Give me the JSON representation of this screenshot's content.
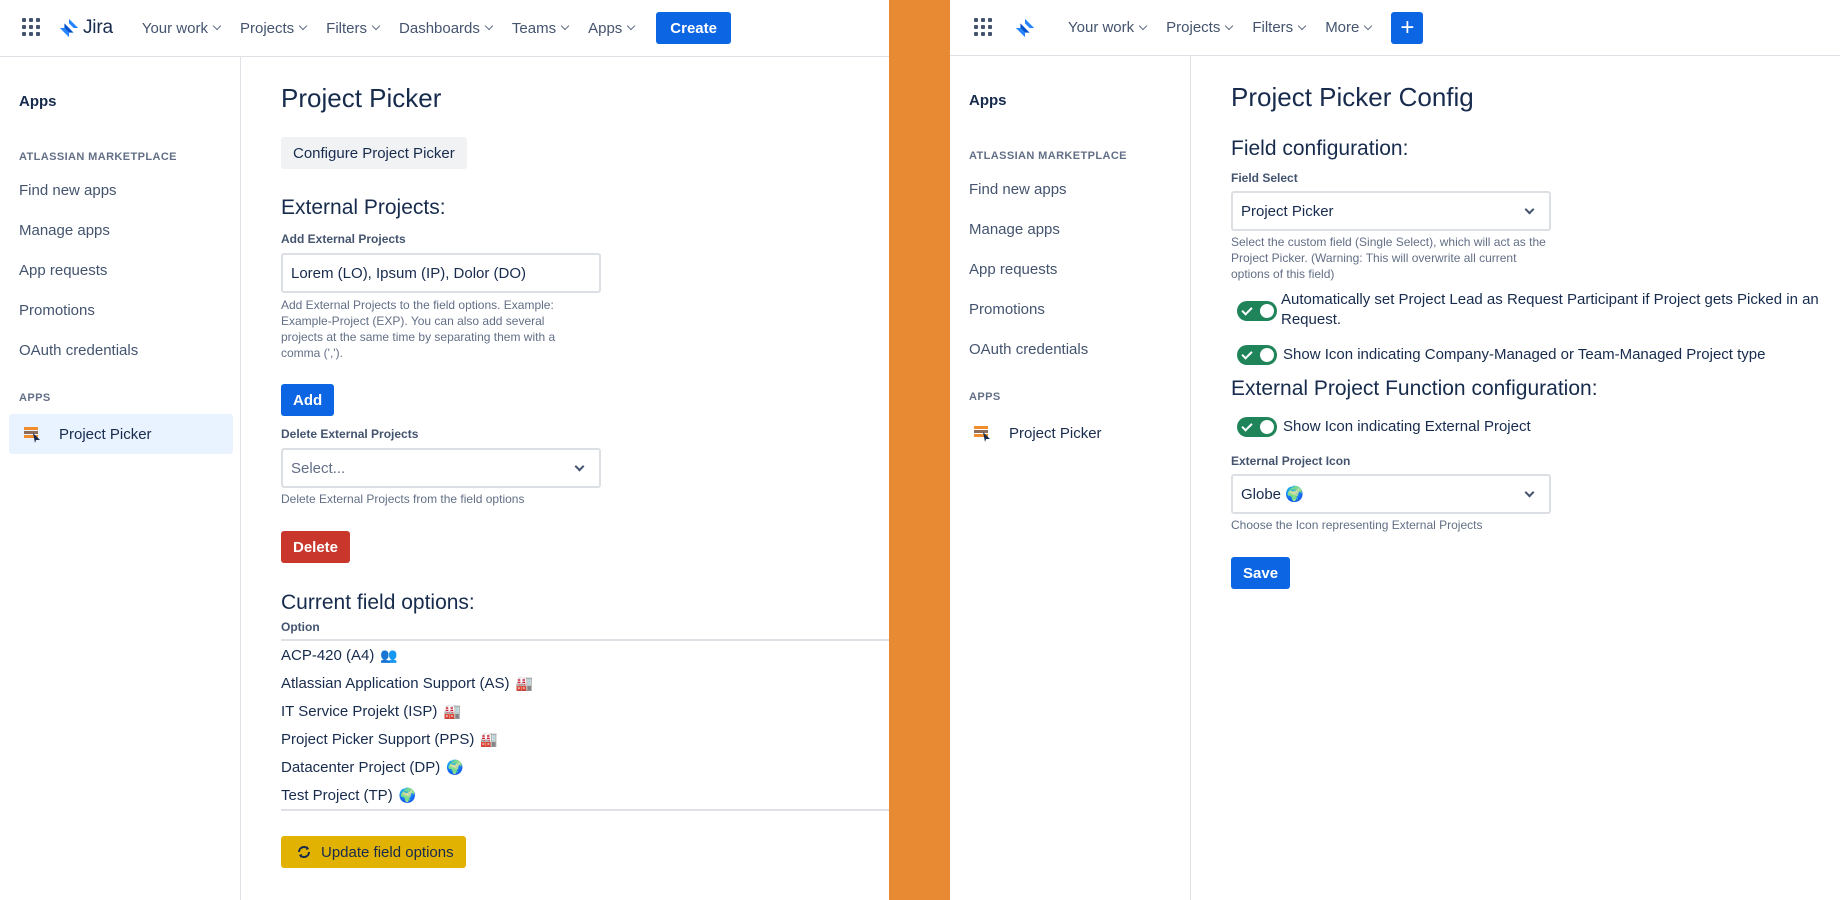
{
  "colors": {
    "divider_band": "#e88a34",
    "primary": "#0c66e4",
    "danger": "#c9372c",
    "warning": "#e2b203",
    "toggle_on": "#1f845a",
    "sidebar_selected": "#e9f2ff"
  },
  "left": {
    "nav": {
      "logo_text": "Jira",
      "items": [
        "Your work",
        "Projects",
        "Filters",
        "Dashboards",
        "Teams",
        "Apps"
      ],
      "create_label": "Create"
    },
    "sidebar": {
      "title": "Apps",
      "section_marketplace": "ATLASSIAN MARKETPLACE",
      "items": [
        "Find new apps",
        "Manage apps",
        "App requests",
        "Promotions",
        "OAuth credentials"
      ],
      "section_apps": "APPS",
      "app_item": "Project Picker"
    },
    "main": {
      "title": "Project Picker",
      "configure_button": "Configure Project Picker",
      "external_heading": "External Projects:",
      "add_label": "Add External Projects",
      "add_value": "Lorem (LO), Ipsum (IP), Dolor (DO)",
      "add_help": "Add External Projects to the field options. Example: Example-Project (EXP). You can also add several projects at the same time by separating them with a comma (',').",
      "add_button": "Add",
      "delete_label": "Delete External Projects",
      "delete_placeholder": "Select...",
      "delete_help": "Delete External Projects from the field options",
      "delete_button": "Delete",
      "current_heading": "Current field options:",
      "table_header": "Option",
      "options": [
        {
          "text": "ACP-420 (A4)",
          "icon": "👥"
        },
        {
          "text": "Atlassian Application Support (AS)",
          "icon": "🏭"
        },
        {
          "text": "IT Service Projekt (ISP)",
          "icon": "🏭"
        },
        {
          "text": "Project Picker Support (PPS)",
          "icon": "🏭"
        },
        {
          "text": "Datacenter Project (DP)",
          "icon": "🌍"
        },
        {
          "text": "Test Project (TP)",
          "icon": "🌍"
        }
      ],
      "update_button": "Update field options"
    }
  },
  "right": {
    "nav": {
      "items": [
        "Your work",
        "Projects",
        "Filters",
        "More"
      ],
      "plus_label": "+"
    },
    "sidebar": {
      "title": "Apps",
      "section_marketplace": "ATLASSIAN MARKETPLACE",
      "items": [
        "Find new apps",
        "Manage apps",
        "App requests",
        "Promotions",
        "OAuth credentials"
      ],
      "section_apps": "APPS",
      "app_item": "Project Picker"
    },
    "main": {
      "title": "Project Picker Config",
      "field_config_heading": "Field configuration:",
      "field_select_label": "Field Select",
      "field_select_value": "Project Picker",
      "field_select_help": "Select the custom field (Single Select), which will act as the Project Picker. (Warning: This will overwrite all current options of this field)",
      "toggle_1": "Automatically set Project Lead as Request Participant if Project gets Picked in an Request.",
      "toggle_2": "Show Icon indicating Company-Managed or Team-Managed Project type",
      "external_func_heading": "External Project Function configuration:",
      "toggle_3": "Show Icon indicating External Project",
      "icon_label": "External Project Icon",
      "icon_value": "Globe 🌍",
      "icon_help": "Choose the Icon representing External Projects",
      "save_button": "Save"
    }
  }
}
